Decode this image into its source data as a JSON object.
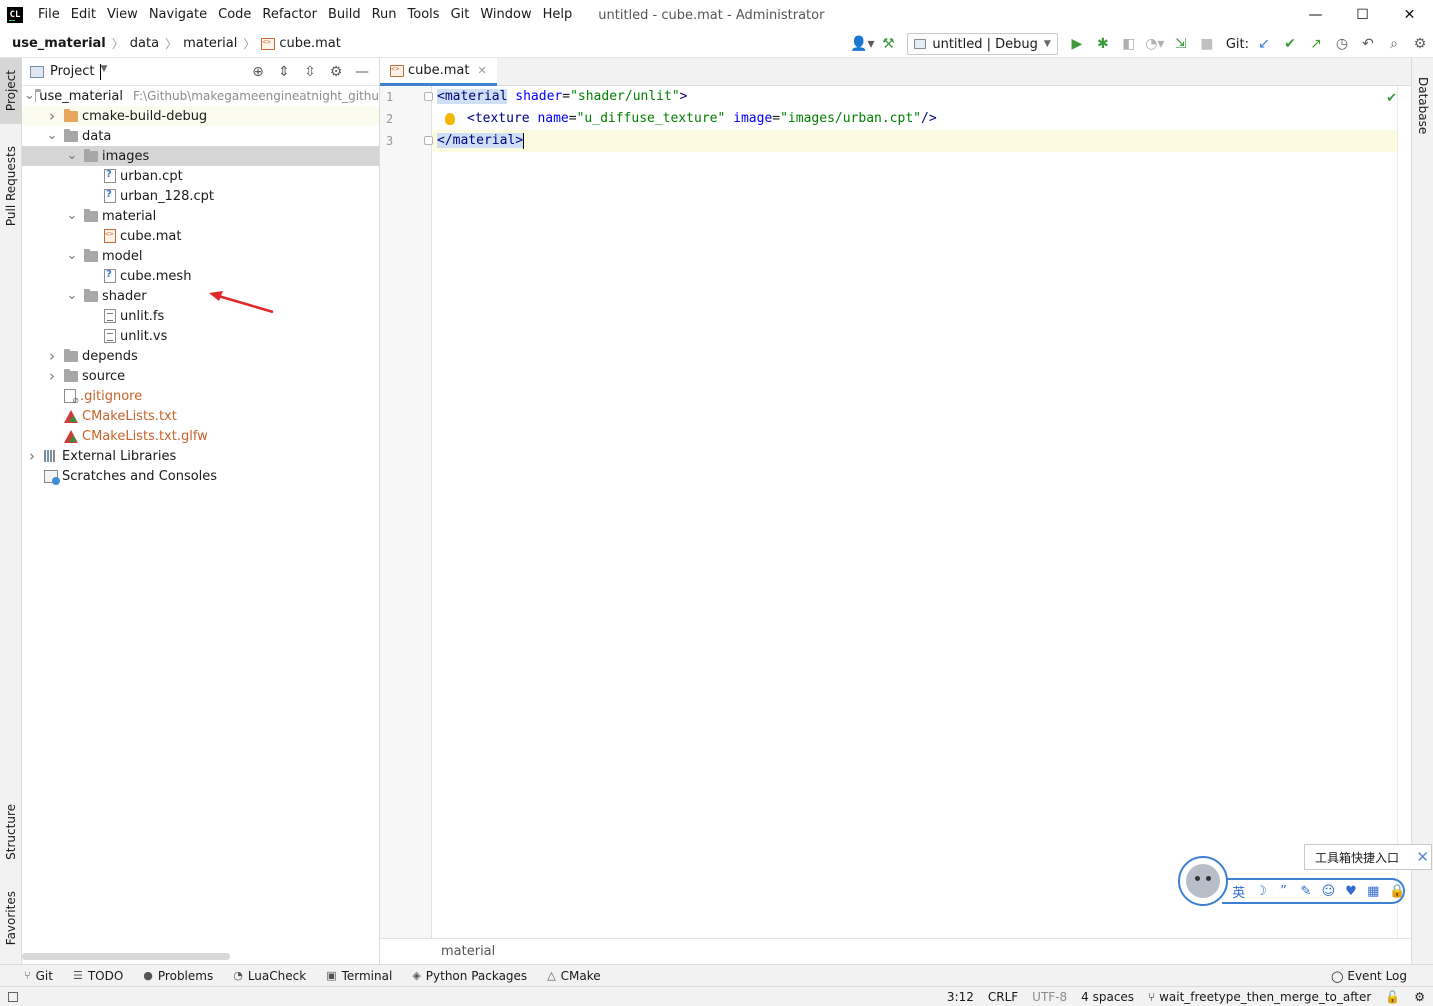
{
  "app": {
    "logo_text": "CL",
    "window_title": "untitled - cube.mat - Administrator"
  },
  "menu": [
    "File",
    "Edit",
    "View",
    "Navigate",
    "Code",
    "Refactor",
    "Build",
    "Run",
    "Tools",
    "Git",
    "Window",
    "Help"
  ],
  "window_controls": {
    "minimize": "—",
    "maximize": "☐",
    "close": "✕"
  },
  "breadcrumb": [
    "use_material",
    "data",
    "material",
    "cube.mat"
  ],
  "toolbar": {
    "run_config": "untitled | Debug",
    "git_label": "Git:"
  },
  "left_stripe": [
    "Project",
    "Pull Requests",
    "Structure",
    "Favorites"
  ],
  "right_stripe": [
    "Database"
  ],
  "project_panel": {
    "title": "Project",
    "tree": [
      {
        "label": "use_material",
        "hint": "F:\\Github\\makegameengineatnight_githu",
        "depth": 0,
        "chevron": "down",
        "icon": "folder"
      },
      {
        "label": "cmake-build-debug",
        "depth": 1,
        "chevron": "right",
        "icon": "folder-orange"
      },
      {
        "label": "data",
        "depth": 1,
        "chevron": "down",
        "icon": "folder"
      },
      {
        "label": "images",
        "depth": 2,
        "chevron": "down",
        "icon": "folder",
        "selected": true
      },
      {
        "label": "urban.cpt",
        "depth": 3,
        "chevron": "",
        "icon": "file-unknown"
      },
      {
        "label": "urban_128.cpt",
        "depth": 3,
        "chevron": "",
        "icon": "file-unknown"
      },
      {
        "label": "material",
        "depth": 2,
        "chevron": "down",
        "icon": "folder"
      },
      {
        "label": "cube.mat",
        "depth": 3,
        "chevron": "",
        "icon": "file-mat"
      },
      {
        "label": "model",
        "depth": 2,
        "chevron": "down",
        "icon": "folder"
      },
      {
        "label": "cube.mesh",
        "depth": 3,
        "chevron": "",
        "icon": "file-unknown"
      },
      {
        "label": "shader",
        "depth": 2,
        "chevron": "down",
        "icon": "folder"
      },
      {
        "label": "unlit.fs",
        "depth": 3,
        "chevron": "",
        "icon": "file-lines"
      },
      {
        "label": "unlit.vs",
        "depth": 3,
        "chevron": "",
        "icon": "file-lines"
      },
      {
        "label": "depends",
        "depth": 1,
        "chevron": "right",
        "icon": "folder"
      },
      {
        "label": "source",
        "depth": 1,
        "chevron": "right",
        "icon": "folder"
      },
      {
        "label": ".gitignore",
        "depth": 1,
        "chevron": "",
        "icon": "file-git",
        "orange": true
      },
      {
        "label": "CMakeLists.txt",
        "depth": 1,
        "chevron": "",
        "icon": "cmake",
        "orange": true
      },
      {
        "label": "CMakeLists.txt.glfw",
        "depth": 1,
        "chevron": "",
        "icon": "cmake",
        "orange": true
      },
      {
        "label": "External Libraries",
        "depth": 0,
        "chevron": "right",
        "icon": "libs"
      },
      {
        "label": "Scratches and Consoles",
        "depth": 0,
        "chevron": "",
        "icon": "scratch"
      }
    ]
  },
  "editor": {
    "tab_label": "cube.mat",
    "line_numbers": [
      "1",
      "2",
      "3"
    ],
    "code": {
      "l1_tag_open": "<material",
      "l1_attr": "shader",
      "l1_eq": "=",
      "l1_val": "\"shader/unlit\"",
      "l1_close": ">",
      "l2_tag_open": "<texture",
      "l2_attr1": "name",
      "l2_val1": "\"u_diffuse_texture\"",
      "l2_attr2": "image",
      "l2_val2": "\"images/urban.cpt\"",
      "l2_close": "/>",
      "l3_tag": "</material>"
    },
    "breadcrumb": "material"
  },
  "tool_tabs": [
    {
      "icon": "⑂",
      "label": "Git"
    },
    {
      "icon": "☰",
      "label": "TODO"
    },
    {
      "icon": "●",
      "label": "Problems"
    },
    {
      "icon": "◔",
      "label": "LuaCheck"
    },
    {
      "icon": "▣",
      "label": "Terminal"
    },
    {
      "icon": "◈",
      "label": "Python Packages"
    },
    {
      "icon": "△",
      "label": "CMake"
    }
  ],
  "event_log": "Event Log",
  "status": {
    "position": "3:12",
    "line_sep": "CRLF",
    "encoding": "UTF-8",
    "indent": "4 spaces",
    "branch": "wait_freetype_then_merge_to_after"
  },
  "ime": {
    "tooltip": "工具箱快捷入口",
    "bar_items": [
      "英",
      "☽",
      "”",
      "✎",
      "☺",
      "♥",
      "▦",
      "🔒"
    ]
  }
}
